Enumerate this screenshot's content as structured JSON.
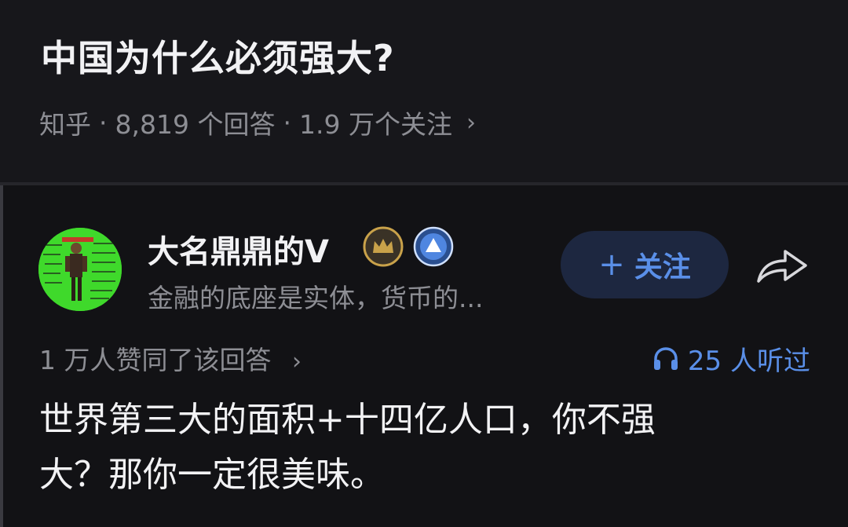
{
  "question": {
    "title": "中国为什么必须强大?",
    "source": "知乎",
    "answers": "8,819 个回答",
    "followers": "1.9 万个关注",
    "chevron": "›"
  },
  "author": {
    "name": "大名鼎鼎的V",
    "bio": "金融的底座是实体，货币的...",
    "follow_label": "关注",
    "follow_plus": "+"
  },
  "stats": {
    "likes": "1 万人赞同了该回答",
    "likes_chevron": "›",
    "listens": "25 人听过"
  },
  "answer": {
    "line1": "世界第三大的面积+十四亿人口，你不强",
    "line2": "大？那你一定很美味。"
  },
  "colors": {
    "accent": "#5a8fe8",
    "background": "#17171b",
    "avatar_bg": "#3fd92b",
    "crown_badge": "#c9a24a"
  },
  "icons": [
    "crown-badge-icon",
    "verified-badge-icon",
    "share-icon",
    "headphones-icon",
    "chevron-right-icon"
  ]
}
